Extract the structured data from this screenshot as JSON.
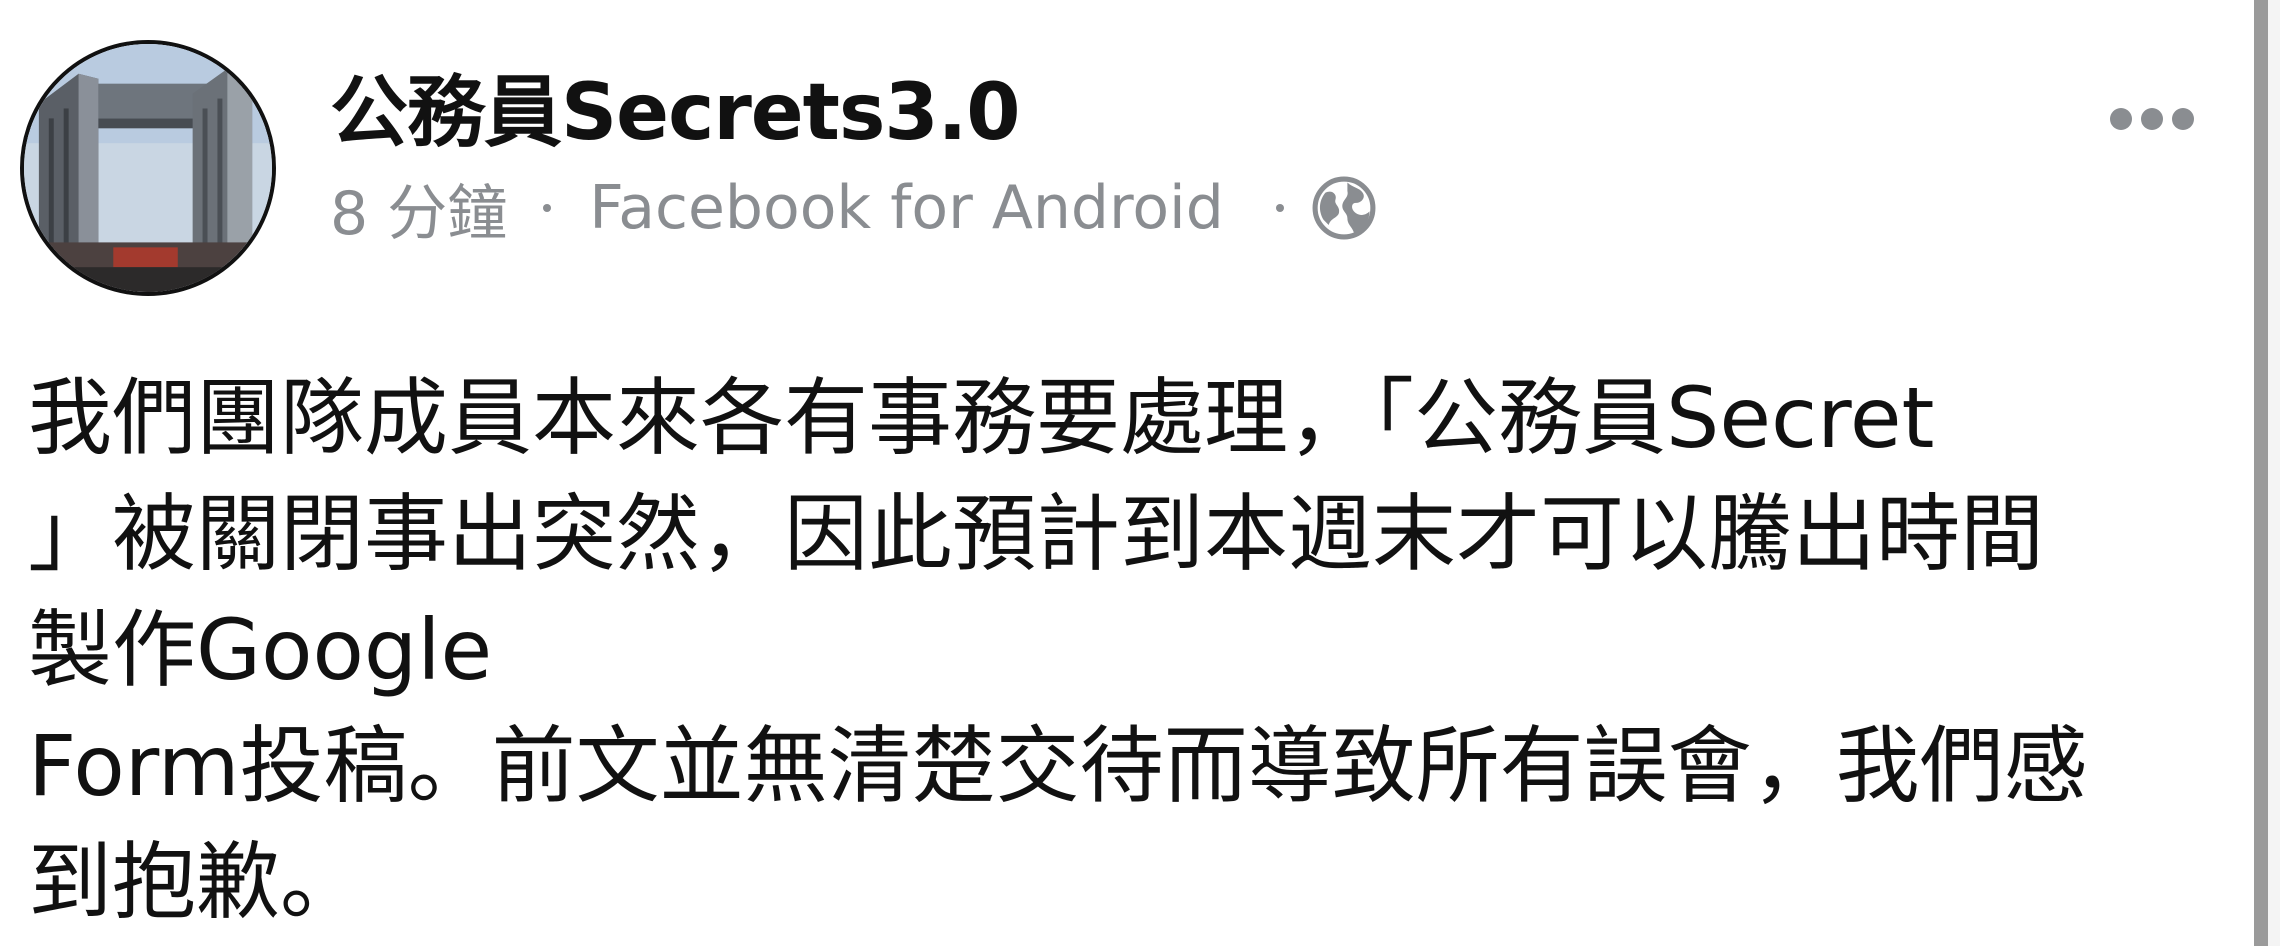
{
  "post": {
    "page_name": "公務員Secrets3.0",
    "time": "8 分鐘",
    "source": "Facebook for Android",
    "privacy_icon": "globe-icon",
    "more_icon": "more-options-icon",
    "body_lines": [
      "我們團隊成員本來各有事務要處理，「公務員Secret",
      "」被關閉事出突然，因此預計到本週末才可以騰出時間",
      "製作Google",
      "Form投稿。前文並無清楚交待而導致所有誤會，我們感",
      "到抱歉。"
    ]
  }
}
